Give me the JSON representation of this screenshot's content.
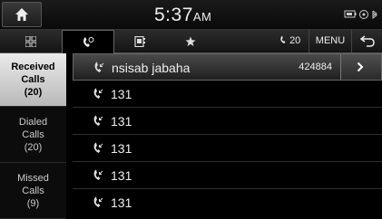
{
  "status": {
    "time": "5:37",
    "ampm": "AM",
    "icons": [
      "battery-icon",
      "signal-icon",
      "bluetooth-icon"
    ]
  },
  "tabs": {
    "items": [
      {
        "icon": "grid-menu-icon"
      },
      {
        "icon": "recent-calls-icon"
      },
      {
        "icon": "contacts-icon"
      },
      {
        "icon": "favorites-star-icon"
      }
    ],
    "call_count": "20",
    "menu_label": "MENU",
    "back_icon": "back-arrow-icon"
  },
  "sidebar": {
    "items": [
      {
        "line1": "Received",
        "line2": "Calls",
        "count": "(20)",
        "active": true
      },
      {
        "line1": "Dialed",
        "line2": "Calls",
        "count": "(20)",
        "active": false
      },
      {
        "line1": "Missed",
        "line2": "Calls",
        "count": "(9)",
        "active": false
      }
    ]
  },
  "calls": [
    {
      "name": "nsisab jabaha",
      "number": "424884",
      "selected": true
    },
    {
      "name": "131",
      "number": "",
      "selected": false
    },
    {
      "name": "131",
      "number": "",
      "selected": false
    },
    {
      "name": "131",
      "number": "",
      "selected": false
    },
    {
      "name": "131",
      "number": "",
      "selected": false
    },
    {
      "name": "131",
      "number": "",
      "selected": false
    }
  ],
  "colors": {
    "background": "#000000",
    "active_tab": "#d9d9d9",
    "text": "#eeeeee"
  }
}
